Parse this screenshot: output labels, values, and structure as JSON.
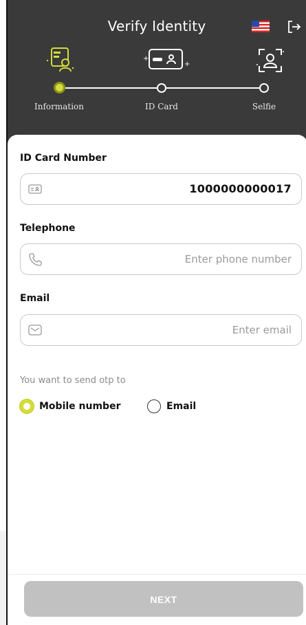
{
  "header": {
    "title": "Verify Identity",
    "accent": "#d4dd3a",
    "steps": [
      {
        "label": "Information",
        "state": "active"
      },
      {
        "label": "ID Card",
        "state": "pending"
      },
      {
        "label": "Selfie",
        "state": "pending"
      }
    ]
  },
  "form": {
    "id_card": {
      "label": "ID Card Number",
      "value": "1000000000017",
      "icon": "id-card-icon"
    },
    "telephone": {
      "label": "Telephone",
      "placeholder": "Enter phone number",
      "icon": "phone-icon"
    },
    "email": {
      "label": "Email",
      "placeholder": "Enter email",
      "icon": "mail-icon"
    },
    "otp": {
      "question": "You want to send otp to",
      "options": [
        {
          "label": "Mobile number",
          "selected": true
        },
        {
          "label": "Email",
          "selected": false
        }
      ]
    }
  },
  "footer": {
    "next_label": "NEXT"
  }
}
